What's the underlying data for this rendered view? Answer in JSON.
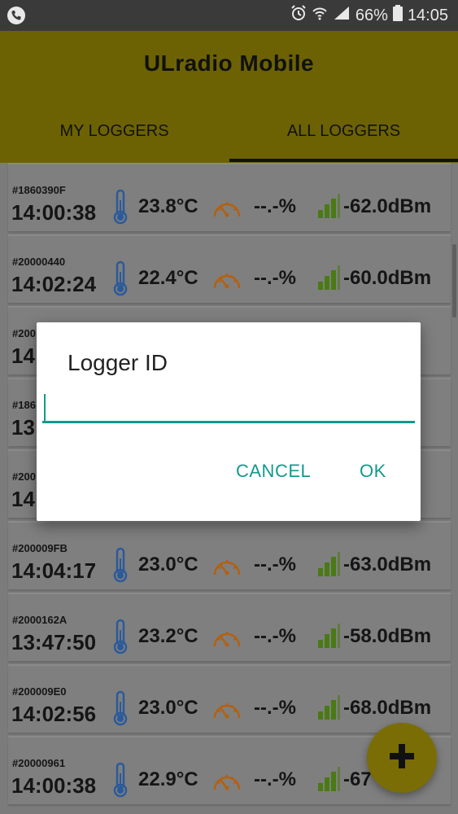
{
  "status_bar": {
    "battery_percent": "66%",
    "time": "14:05",
    "icons": [
      "phone-call-icon",
      "alarm-icon",
      "wifi-icon",
      "signal-icon",
      "battery-icon"
    ]
  },
  "app": {
    "title": "ULradio Mobile",
    "tabs": [
      {
        "label": "MY LOGGERS",
        "selected": false
      },
      {
        "label": "ALL LOGGERS",
        "selected": true
      }
    ]
  },
  "loggers": [
    {
      "id": "#1860390F",
      "time": "14:00:38",
      "temp": "23.8°C",
      "humidity": "--.-%",
      "rssi": "-62.0dBm"
    },
    {
      "id": "#20000440",
      "time": "14:02:24",
      "temp": "22.4°C",
      "humidity": "--.-%",
      "rssi": "-60.0dBm"
    },
    {
      "id": "#200",
      "time": "14",
      "temp": "",
      "humidity": "",
      "rssi": "Bm"
    },
    {
      "id": "#186",
      "time": "13",
      "temp": "",
      "humidity": "",
      "rssi": "Bm"
    },
    {
      "id": "#200",
      "time": "14",
      "temp": "",
      "humidity": "",
      "rssi": "Bm"
    },
    {
      "id": "#200009FB",
      "time": "14:04:17",
      "temp": "23.0°C",
      "humidity": "--.-%",
      "rssi": "-63.0dBm"
    },
    {
      "id": "#2000162A",
      "time": "13:47:50",
      "temp": "23.2°C",
      "humidity": "--.-%",
      "rssi": "-58.0dBm"
    },
    {
      "id": "#200009E0",
      "time": "14:02:56",
      "temp": "23.0°C",
      "humidity": "--.-%",
      "rssi": "-68.0dBm"
    },
    {
      "id": "#20000961",
      "time": "14:00:38",
      "temp": "22.9°C",
      "humidity": "--.-%",
      "rssi": "-67"
    }
  ],
  "dialog": {
    "title": "Logger ID",
    "input_value": "",
    "cancel_label": "CANCEL",
    "ok_label": "OK"
  },
  "fab": {
    "icon": "plus-icon"
  },
  "colors": {
    "app_bar": "#6c6203",
    "accent": "#129a8e",
    "signal_green": "#4a7a14",
    "gauge_orange": "#b4600f",
    "thermometer_blue": "#2b5a9a"
  }
}
